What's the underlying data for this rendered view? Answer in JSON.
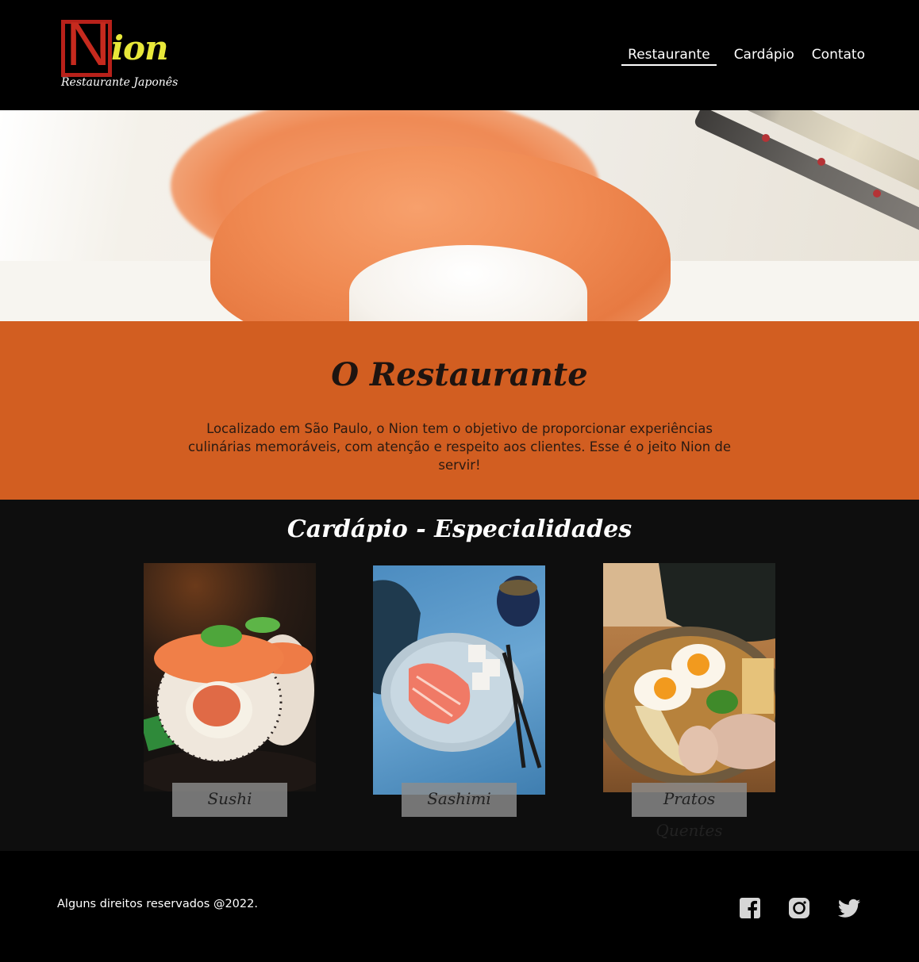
{
  "header": {
    "logo_letter": "N",
    "logo_word": "ion",
    "logo_tagline": "Restaurante Japonês",
    "nav": [
      {
        "label": "Restaurante",
        "active": true
      },
      {
        "label": "Cardápio",
        "active": false
      },
      {
        "label": "Contato",
        "active": false
      }
    ]
  },
  "about": {
    "title": "O Restaurante",
    "text": "Localizado em São Paulo, o Nion tem o objetivo de proporcionar experiências culinárias memoráveis, com atenção e respeito aos clientes. Esse é o jeito Nion de servir!"
  },
  "menu": {
    "title": "Cardápio - Especialidades",
    "items": [
      {
        "label": "Sushi"
      },
      {
        "label": "Sashimi"
      },
      {
        "label": "Pratos Quentes"
      }
    ]
  },
  "footer": {
    "copyright": "Alguns direitos reservados @2022.",
    "social": [
      "facebook-icon",
      "instagram-icon",
      "twitter-icon"
    ]
  },
  "colors": {
    "accent": "#d25e21",
    "logo_red": "#c62a1e",
    "logo_yellow": "#e8e83a",
    "menu_bg": "#0e0e0e"
  }
}
